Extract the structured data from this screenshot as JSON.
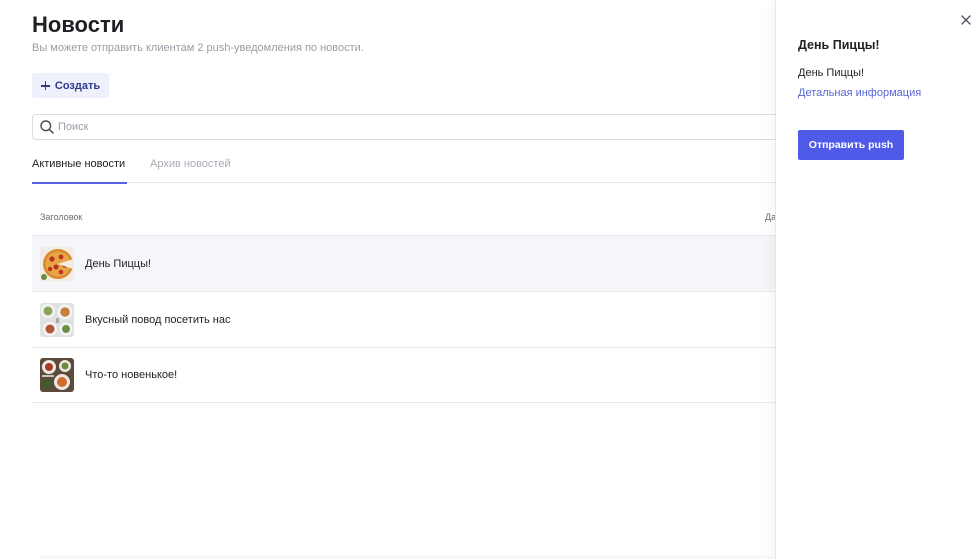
{
  "header": {
    "title": "Новости",
    "subtitle": "Вы можете отправить клиентам 2 push-уведомления по новости.",
    "create_label": "Создать"
  },
  "search": {
    "placeholder": "Поиск",
    "value": ""
  },
  "tabs": [
    {
      "label": "Активные новости",
      "active": true
    },
    {
      "label": "Архив новостей",
      "active": false
    }
  ],
  "table": {
    "columns": [
      "Заголовок",
      "Да"
    ],
    "rows": [
      {
        "title": "День Пиццы!",
        "thumbnail": "pizza-image",
        "selected": true
      },
      {
        "title": "Вкусный повод посетить нас",
        "thumbnail": "dishes-image",
        "selected": false
      },
      {
        "title": "Что-то новенькое!",
        "thumbnail": "food-table-image",
        "selected": false
      }
    ]
  },
  "panel": {
    "title": "День Пиццы!",
    "text": "День Пиццы!",
    "link_label": "Детальная информация",
    "push_button_label": "Отправить push"
  },
  "colors": {
    "accent": "#4f5be8",
    "link": "#5866d8",
    "create_bg": "#eef0fb",
    "selected_row_bg": "#f4f6fa"
  }
}
